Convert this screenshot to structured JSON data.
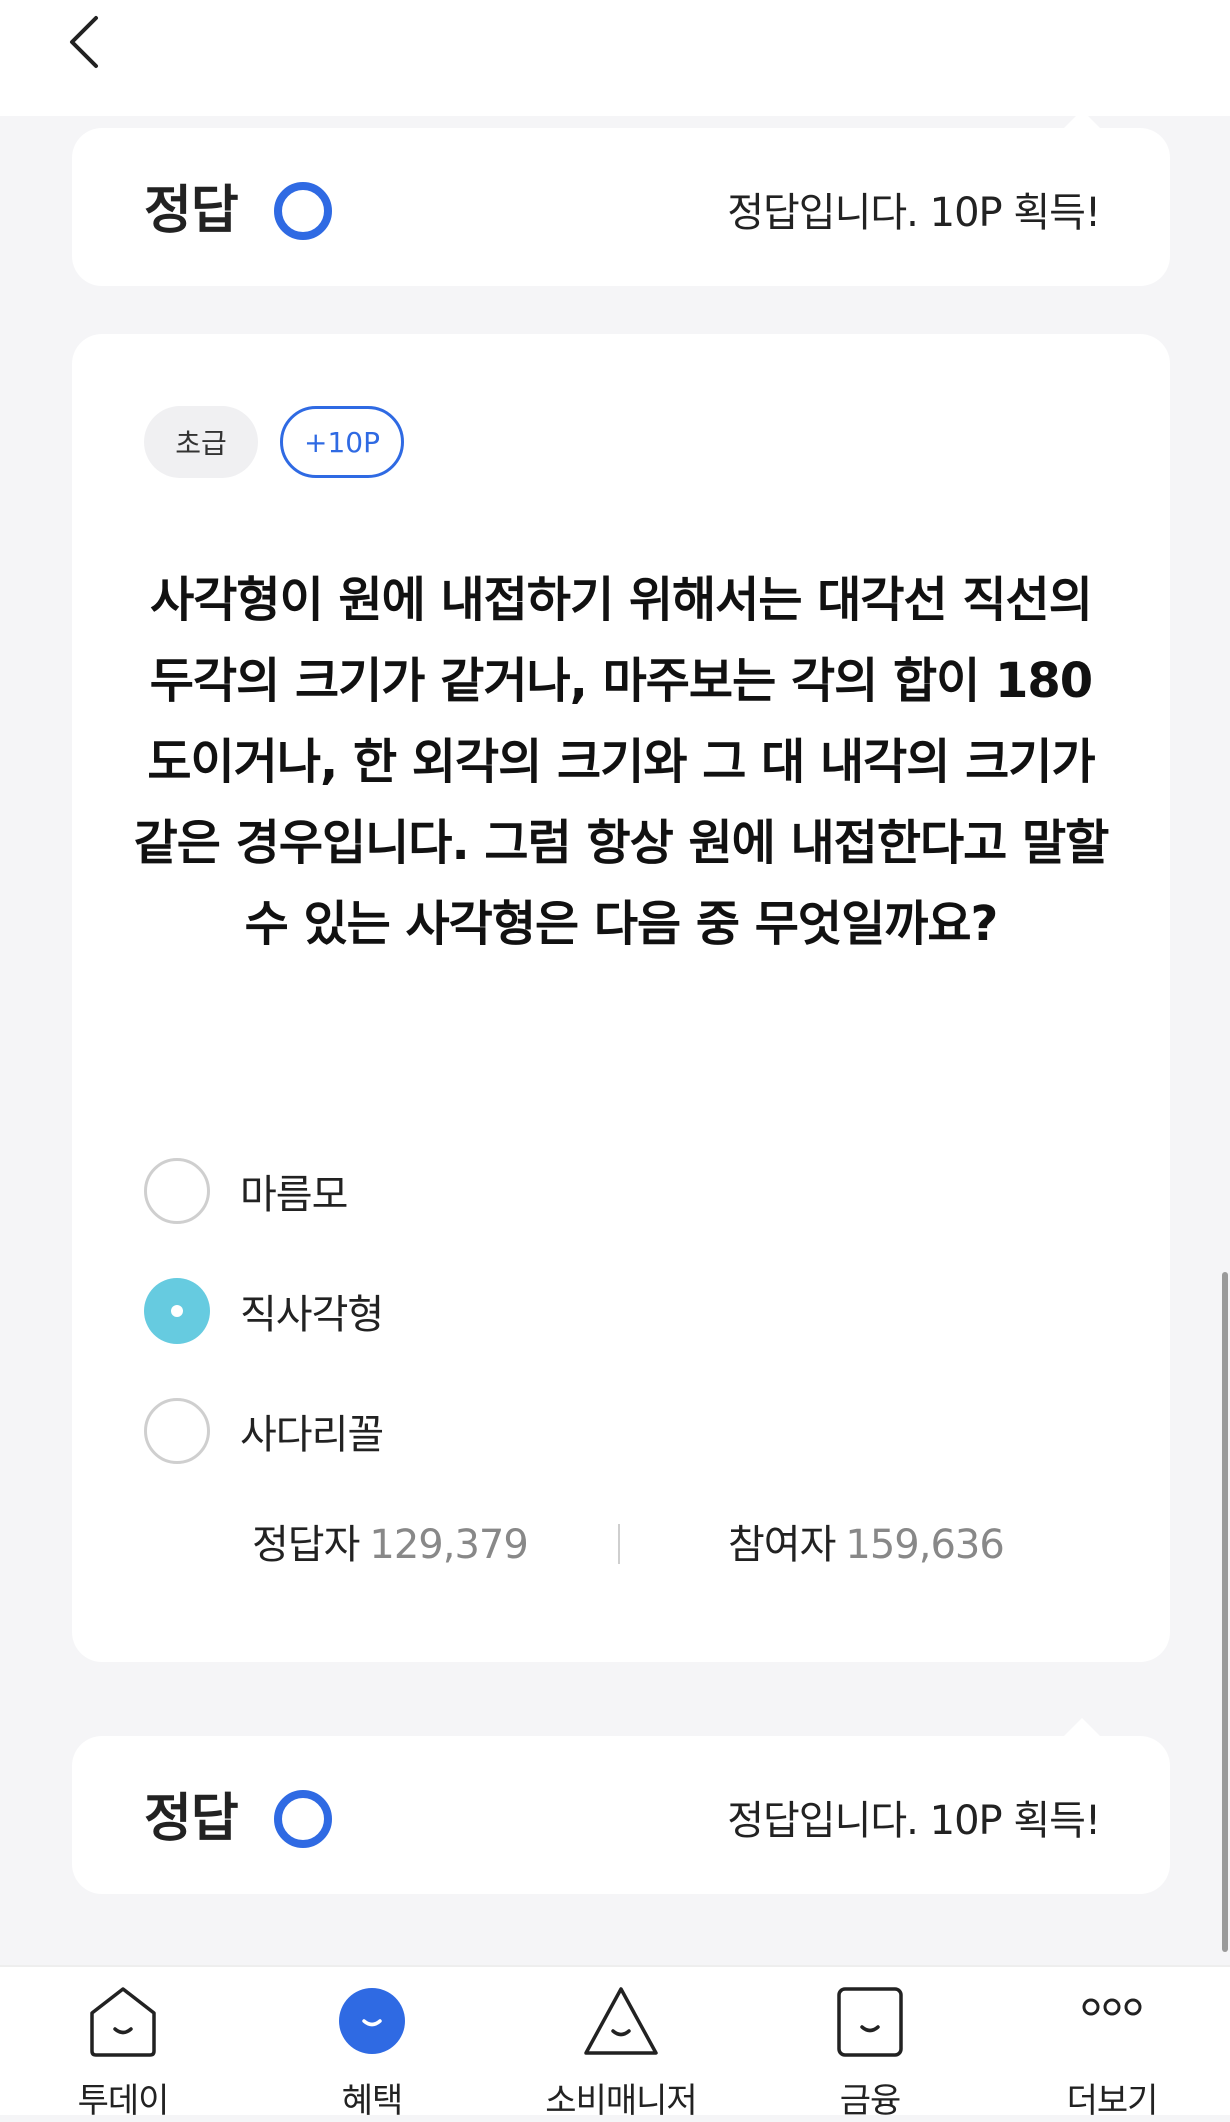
{
  "header": {
    "back_icon": "chevron-left-icon"
  },
  "answer_banner_top": {
    "label": "정답",
    "mark": "circle-o",
    "message": "정답입니다. 10P 획득!",
    "mark_color": "#2f6ae3"
  },
  "quiz": {
    "level_chip": "초급",
    "points_chip": "+10P",
    "question": "사각형이 원에 내접하기 위해서는 대각선 직선의 두각의 크기가 같거나, 마주보는 각의 합이 180도이거나, 한 외각의 크기와 그 대 내각의 크기가 같은 경우입니다. 그럼 항상 원에 내접한다고 말할수 있는 사각형은 다음 중 무엇일까요?",
    "options": [
      {
        "label": "마름모",
        "selected": false
      },
      {
        "label": "직사각형",
        "selected": true
      },
      {
        "label": "사다리꼴",
        "selected": false
      }
    ],
    "selected_color": "#66cbe0",
    "stats": {
      "correct_label": "정답자",
      "correct_value": "129,379",
      "participants_label": "참여자",
      "participants_value": "159,636"
    }
  },
  "answer_banner_bottom": {
    "label": "정답",
    "mark": "circle-o",
    "message": "정답입니다. 10P 획득!"
  },
  "bottom_nav": {
    "items": [
      {
        "label": "투데이",
        "icon": "home-smile-icon",
        "active": false
      },
      {
        "label": "혜택",
        "icon": "benefit-smile-icon",
        "active": true
      },
      {
        "label": "소비매니저",
        "icon": "triangle-smile-icon",
        "active": false
      },
      {
        "label": "금융",
        "icon": "square-smile-icon",
        "active": false
      },
      {
        "label": "더보기",
        "icon": "more-dots-icon",
        "active": false
      }
    ],
    "active_color": "#2f6ae3"
  }
}
